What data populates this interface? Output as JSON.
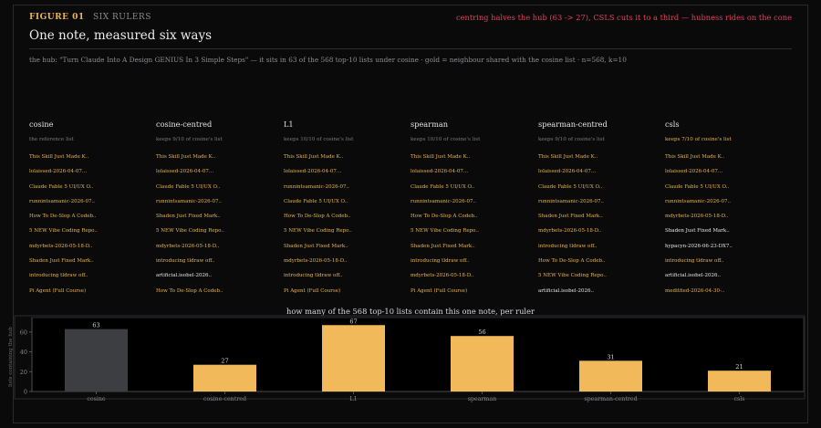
{
  "header": {
    "figure_label": "FIGURE 01",
    "figure_sub": "SIX RULERS",
    "callout": "centring halves the hub (63 -> 27), CSLS cuts it to a third — hubness rides on the cone",
    "title": "One note, measured six ways",
    "description": "the hub: \"Turn Claude Into A Design GENIUS In 3 Simple Steps\" — it sits in 63 of the 568 top-10 lists under cosine  ·  gold = neighbour shared with the cosine list  ·  n=568, k=10"
  },
  "columns": [
    {
      "name": "cosine",
      "kept": "the reference list",
      "items": [
        {
          "t": "This Skill Just Made K..",
          "shared": true
        },
        {
          "t": "lolaissed-2026-04-07...",
          "shared": true
        },
        {
          "t": "Claude Fable 5 UI/UX O..",
          "shared": true
        },
        {
          "t": "runnintsamanic-2026-07..",
          "shared": true
        },
        {
          "t": "How To De-Slop A Codeb..",
          "shared": true
        },
        {
          "t": "5 NEW Vibe Coding Repo..",
          "shared": true
        },
        {
          "t": "mdyrbets-2026-05-18-D..",
          "shared": true
        },
        {
          "t": "Shaden Just Fixed Mark..",
          "shared": true
        },
        {
          "t": "introducing tldraw off..",
          "shared": true
        },
        {
          "t": "Pi Agent (Full Course)",
          "shared": true
        }
      ]
    },
    {
      "name": "cosine-centred",
      "kept": "keeps 9/10 of cosine's list",
      "items": [
        {
          "t": "This Skill Just Made K..",
          "shared": true
        },
        {
          "t": "lolaissed-2026-04-07...",
          "shared": true
        },
        {
          "t": "Claude Fable 5 UI/UX O..",
          "shared": true
        },
        {
          "t": "runnintsamanic-2026-07..",
          "shared": true
        },
        {
          "t": "Shaden Just Fixed Mark..",
          "shared": true
        },
        {
          "t": "5 NEW Vibe Coding Repo..",
          "shared": true
        },
        {
          "t": "mdyrbets-2026-05-18-D..",
          "shared": true
        },
        {
          "t": "introducing tldraw off..",
          "shared": true
        },
        {
          "t": "artificial.isobel-2026..",
          "shared": false
        },
        {
          "t": "How To De-Slop A Codeb..",
          "shared": true
        }
      ]
    },
    {
      "name": "L1",
      "kept": "keeps 10/10 of cosine's list",
      "items": [
        {
          "t": "This Skill Just Made K..",
          "shared": true
        },
        {
          "t": "lolaissed-2026-04-07...",
          "shared": true
        },
        {
          "t": "runnintsamanic-2026-07..",
          "shared": true
        },
        {
          "t": "Claude Fable 5 UI/UX O..",
          "shared": true
        },
        {
          "t": "How To De-Slop A Codeb..",
          "shared": true
        },
        {
          "t": "5 NEW Vibe Coding Repo..",
          "shared": true
        },
        {
          "t": "Shaden Just Fixed Mark..",
          "shared": true
        },
        {
          "t": "mdyrbets-2026-05-18-D..",
          "shared": true
        },
        {
          "t": "introducing tldraw off..",
          "shared": true
        },
        {
          "t": "Pi Agent (Full Course)",
          "shared": true
        }
      ]
    },
    {
      "name": "spearman",
      "kept": "keeps 10/10 of cosine's list",
      "items": [
        {
          "t": "This Skill Just Made K..",
          "shared": true
        },
        {
          "t": "lolaissed-2026-04-07...",
          "shared": true
        },
        {
          "t": "Claude Fable 5 UI/UX O..",
          "shared": true
        },
        {
          "t": "runnintsamanic-2026-07..",
          "shared": true
        },
        {
          "t": "How To De-Slop A Codeb..",
          "shared": true
        },
        {
          "t": "5 NEW Vibe Coding Repo..",
          "shared": true
        },
        {
          "t": "Shaden Just Fixed Mark..",
          "shared": true
        },
        {
          "t": "introducing tldraw off..",
          "shared": true
        },
        {
          "t": "mdyrbets-2026-05-18-D..",
          "shared": true
        },
        {
          "t": "Pi Agent (Full Course)",
          "shared": true
        }
      ]
    },
    {
      "name": "spearman-centred",
      "kept": "keeps 9/10 of cosine's list",
      "items": [
        {
          "t": "This Skill Just Made K..",
          "shared": true
        },
        {
          "t": "lolaissed-2026-04-07...",
          "shared": true
        },
        {
          "t": "Claude Fable 5 UI/UX O..",
          "shared": true
        },
        {
          "t": "runnintsamanic-2026-07..",
          "shared": true
        },
        {
          "t": "Shaden Just Fixed Mark..",
          "shared": true
        },
        {
          "t": "mdyrbets-2026-05-18-D..",
          "shared": true
        },
        {
          "t": "introducing tldraw off..",
          "shared": true
        },
        {
          "t": "How To De-Slop A Codeb..",
          "shared": true
        },
        {
          "t": "5 NEW Vibe Coding Repo..",
          "shared": true
        },
        {
          "t": "artificial.isobel-2026..",
          "shared": false
        }
      ]
    },
    {
      "name": "csls",
      "kept": "keeps 7/10 of cosine's list",
      "items": [
        {
          "t": "This Skill Just Made K..",
          "shared": true
        },
        {
          "t": "lolaissed-2026-04-07...",
          "shared": true
        },
        {
          "t": "Claude Fable 5 UI/UX O..",
          "shared": true
        },
        {
          "t": "runnintsamanic-2026-07..",
          "shared": true
        },
        {
          "t": "mdyrbets-2026-05-18-D..",
          "shared": true
        },
        {
          "t": "Shaden Just Fixed Mark..",
          "shared": false
        },
        {
          "t": "hypacyn-2026-06-23-DX7..",
          "shared": false
        },
        {
          "t": "introducing tldraw off..",
          "shared": true
        },
        {
          "t": "artificial.isobel-2026..",
          "shared": false
        },
        {
          "t": "meditfied-2026-04-30-..",
          "shared": true
        }
      ]
    }
  ],
  "colors": {
    "gold": "#f2b95a",
    "reference": "#3d3e42",
    "white": "#e6e6e6"
  },
  "chart_data": {
    "type": "bar",
    "title": "how many of the 568 top-10 lists contain this one note, per ruler",
    "ylabel": "lists containing the hub",
    "xlabel": "",
    "categories": [
      "cosine",
      "cosine-centred",
      "L1",
      "spearman",
      "spearman-centred",
      "csls"
    ],
    "values": [
      63,
      27,
      67,
      56,
      31,
      21
    ],
    "data_labels": [
      "63",
      "27",
      "67",
      "56",
      "31",
      "21"
    ],
    "yticks": [
      0,
      20,
      40,
      60
    ],
    "ylim": [
      0,
      70
    ],
    "bar_colors": [
      "#3d3e42",
      "#f2b95a",
      "#f2b95a",
      "#f2b95a",
      "#f2b95a",
      "#f2b95a"
    ],
    "grid": false
  }
}
